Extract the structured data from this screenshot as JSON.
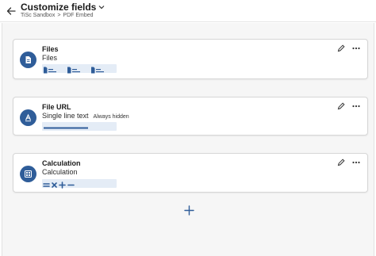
{
  "header": {
    "title": "Customize fields",
    "breadcrumb": [
      "TiSc Sandbox",
      ">",
      "PDF Embed"
    ]
  },
  "cards": [
    {
      "title": "Files",
      "subtitle": "Files",
      "icon": "file-icon"
    },
    {
      "title": "File URL",
      "subtitle": "Single line text",
      "note": "Always hidden",
      "icon": "text-a-icon"
    },
    {
      "title": "Calculation",
      "subtitle": "Calculation",
      "icon": "calculator-icon"
    }
  ],
  "colors": {
    "accent": "#2f5d99",
    "preview_bg": "#e4ecf6",
    "background": "#f6f6f6"
  }
}
